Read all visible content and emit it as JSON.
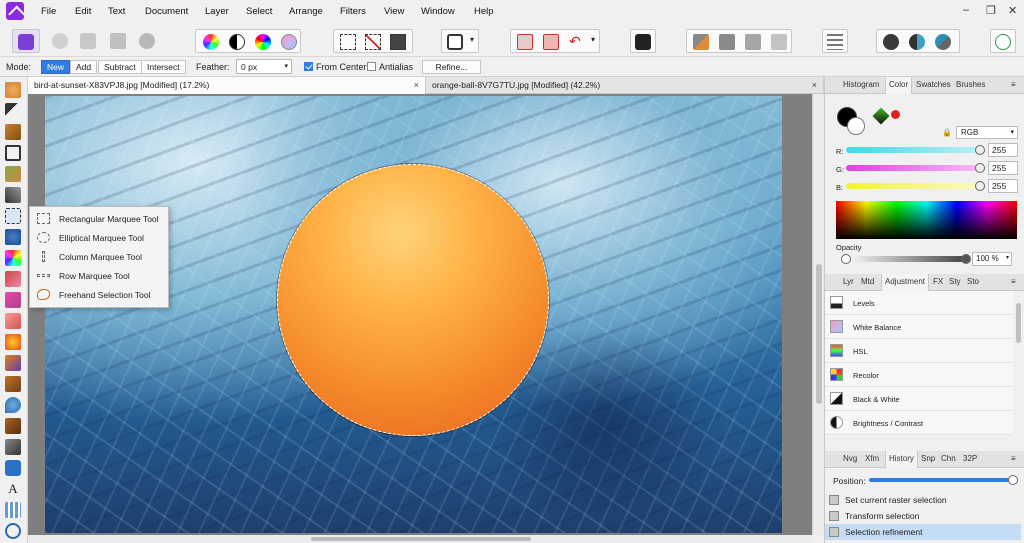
{
  "menubar": {
    "items": [
      "File",
      "Edit",
      "Text",
      "Document",
      "Layer",
      "Select",
      "Arrange",
      "Filters",
      "View",
      "Window",
      "Help"
    ]
  },
  "context_bar": {
    "mode_label": "Mode:",
    "modes": [
      "New",
      "Add",
      "Subtract",
      "Intersect"
    ],
    "active_mode": "New",
    "feather_label": "Feather:",
    "feather_value": "0 px",
    "from_center_label": "From Center",
    "from_center_checked": true,
    "antialias_label": "Antialias",
    "antialias_checked": false,
    "refine_label": "Refine..."
  },
  "documents": {
    "tabs": [
      {
        "title": "bird-at-sunset-X83VPJ8.jpg [Modified] (17.2%)",
        "active": true
      },
      {
        "title": "orange-ball-8V7G7TU.jpg [Modified] (42.2%)",
        "active": false
      }
    ],
    "close_glyph": "×"
  },
  "selection_flyout": {
    "items": [
      "Rectangular Marquee Tool",
      "Elliptical Marquee Tool",
      "Column Marquee Tool",
      "Row Marquee Tool",
      "Freehand Selection Tool"
    ]
  },
  "color_panel": {
    "tabs": [
      "Histogram",
      "Color",
      "Swatches",
      "Brushes"
    ],
    "active_tab": "Color",
    "model": "RGB",
    "r_label": "R:",
    "r_value": "255",
    "g_label": "G:",
    "g_value": "255",
    "b_label": "B:",
    "b_value": "255",
    "opacity_label": "Opacity",
    "opacity_value": "100 %",
    "colors": {
      "r_track": "#40d8e8",
      "g_track": "#e040e0",
      "b_track": "#f0f040"
    }
  },
  "adjustment_panel": {
    "tabs": [
      "Lyr",
      "Mtd",
      "Adjustment",
      "FX",
      "Sty",
      "Sto"
    ],
    "active_tab": "Adjustment",
    "items": [
      "Levels",
      "White Balance",
      "HSL",
      "Recolor",
      "Black & White",
      "Brightness / Contrast"
    ]
  },
  "history_panel": {
    "tabs": [
      "Nvg",
      "Xfm",
      "History",
      "Snp",
      "Chn",
      "32P"
    ],
    "active_tab": "History",
    "position_label": "Position:",
    "items": [
      "Set current raster selection",
      "Transform selection",
      "Selection refinement"
    ],
    "selected_item": "Selection refinement"
  },
  "colors": {
    "accent": "#2f7de1",
    "selected_row": "#c5dcf5"
  }
}
